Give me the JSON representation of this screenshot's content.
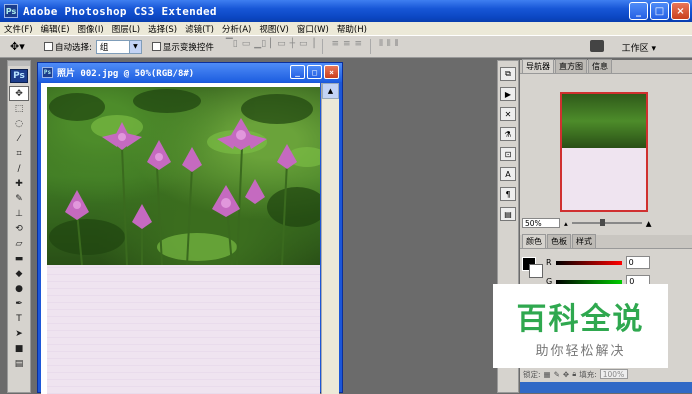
{
  "app": {
    "title": "Adobe Photoshop CS3 Extended",
    "icon_label": "Ps",
    "window_buttons": [
      "_",
      "□",
      "×"
    ]
  },
  "menu": [
    "文件(F)",
    "编辑(E)",
    "图像(I)",
    "图层(L)",
    "选择(S)",
    "滤镜(T)",
    "分析(A)",
    "视图(V)",
    "窗口(W)",
    "帮助(H)"
  ],
  "options": {
    "auto_select_label": "自动选择:",
    "auto_select_value": "组",
    "show_transform_label": "显示变换控件",
    "workspace_label": "工作区 ▾"
  },
  "toolbox": {
    "logo": "Ps",
    "tools": [
      "move",
      "marquee",
      "lasso",
      "magic-wand",
      "crop",
      "slice",
      "healing",
      "brush",
      "stamp",
      "history-brush",
      "eraser",
      "gradient",
      "blur",
      "dodge",
      "pen",
      "type",
      "path-select",
      "shape",
      "notes",
      "eyedropper"
    ]
  },
  "document": {
    "title": "照片 002.jpg @ 50%(RGB/8#)",
    "doc_icon": "Ps"
  },
  "navigator": {
    "tabs": [
      "导航器",
      "直方图",
      "信息"
    ],
    "zoom": "50%"
  },
  "color_panel": {
    "tabs": [
      "颜色",
      "色板",
      "样式"
    ],
    "r_label": "R",
    "g_label": "G",
    "r_value": "0",
    "g_value": "0"
  },
  "layers": {
    "lock_label": "锁定:",
    "fill_label": "填充:",
    "fill_value": "100%"
  },
  "watermark": {
    "title": "百科全说",
    "subtitle": "助你轻松解决"
  },
  "colors": {
    "xp_blue": "#1d5ee0",
    "panel_gray": "#d6d3ce",
    "workspace_gray": "#6b6b6b",
    "watermark_green": "#2fa84f"
  }
}
